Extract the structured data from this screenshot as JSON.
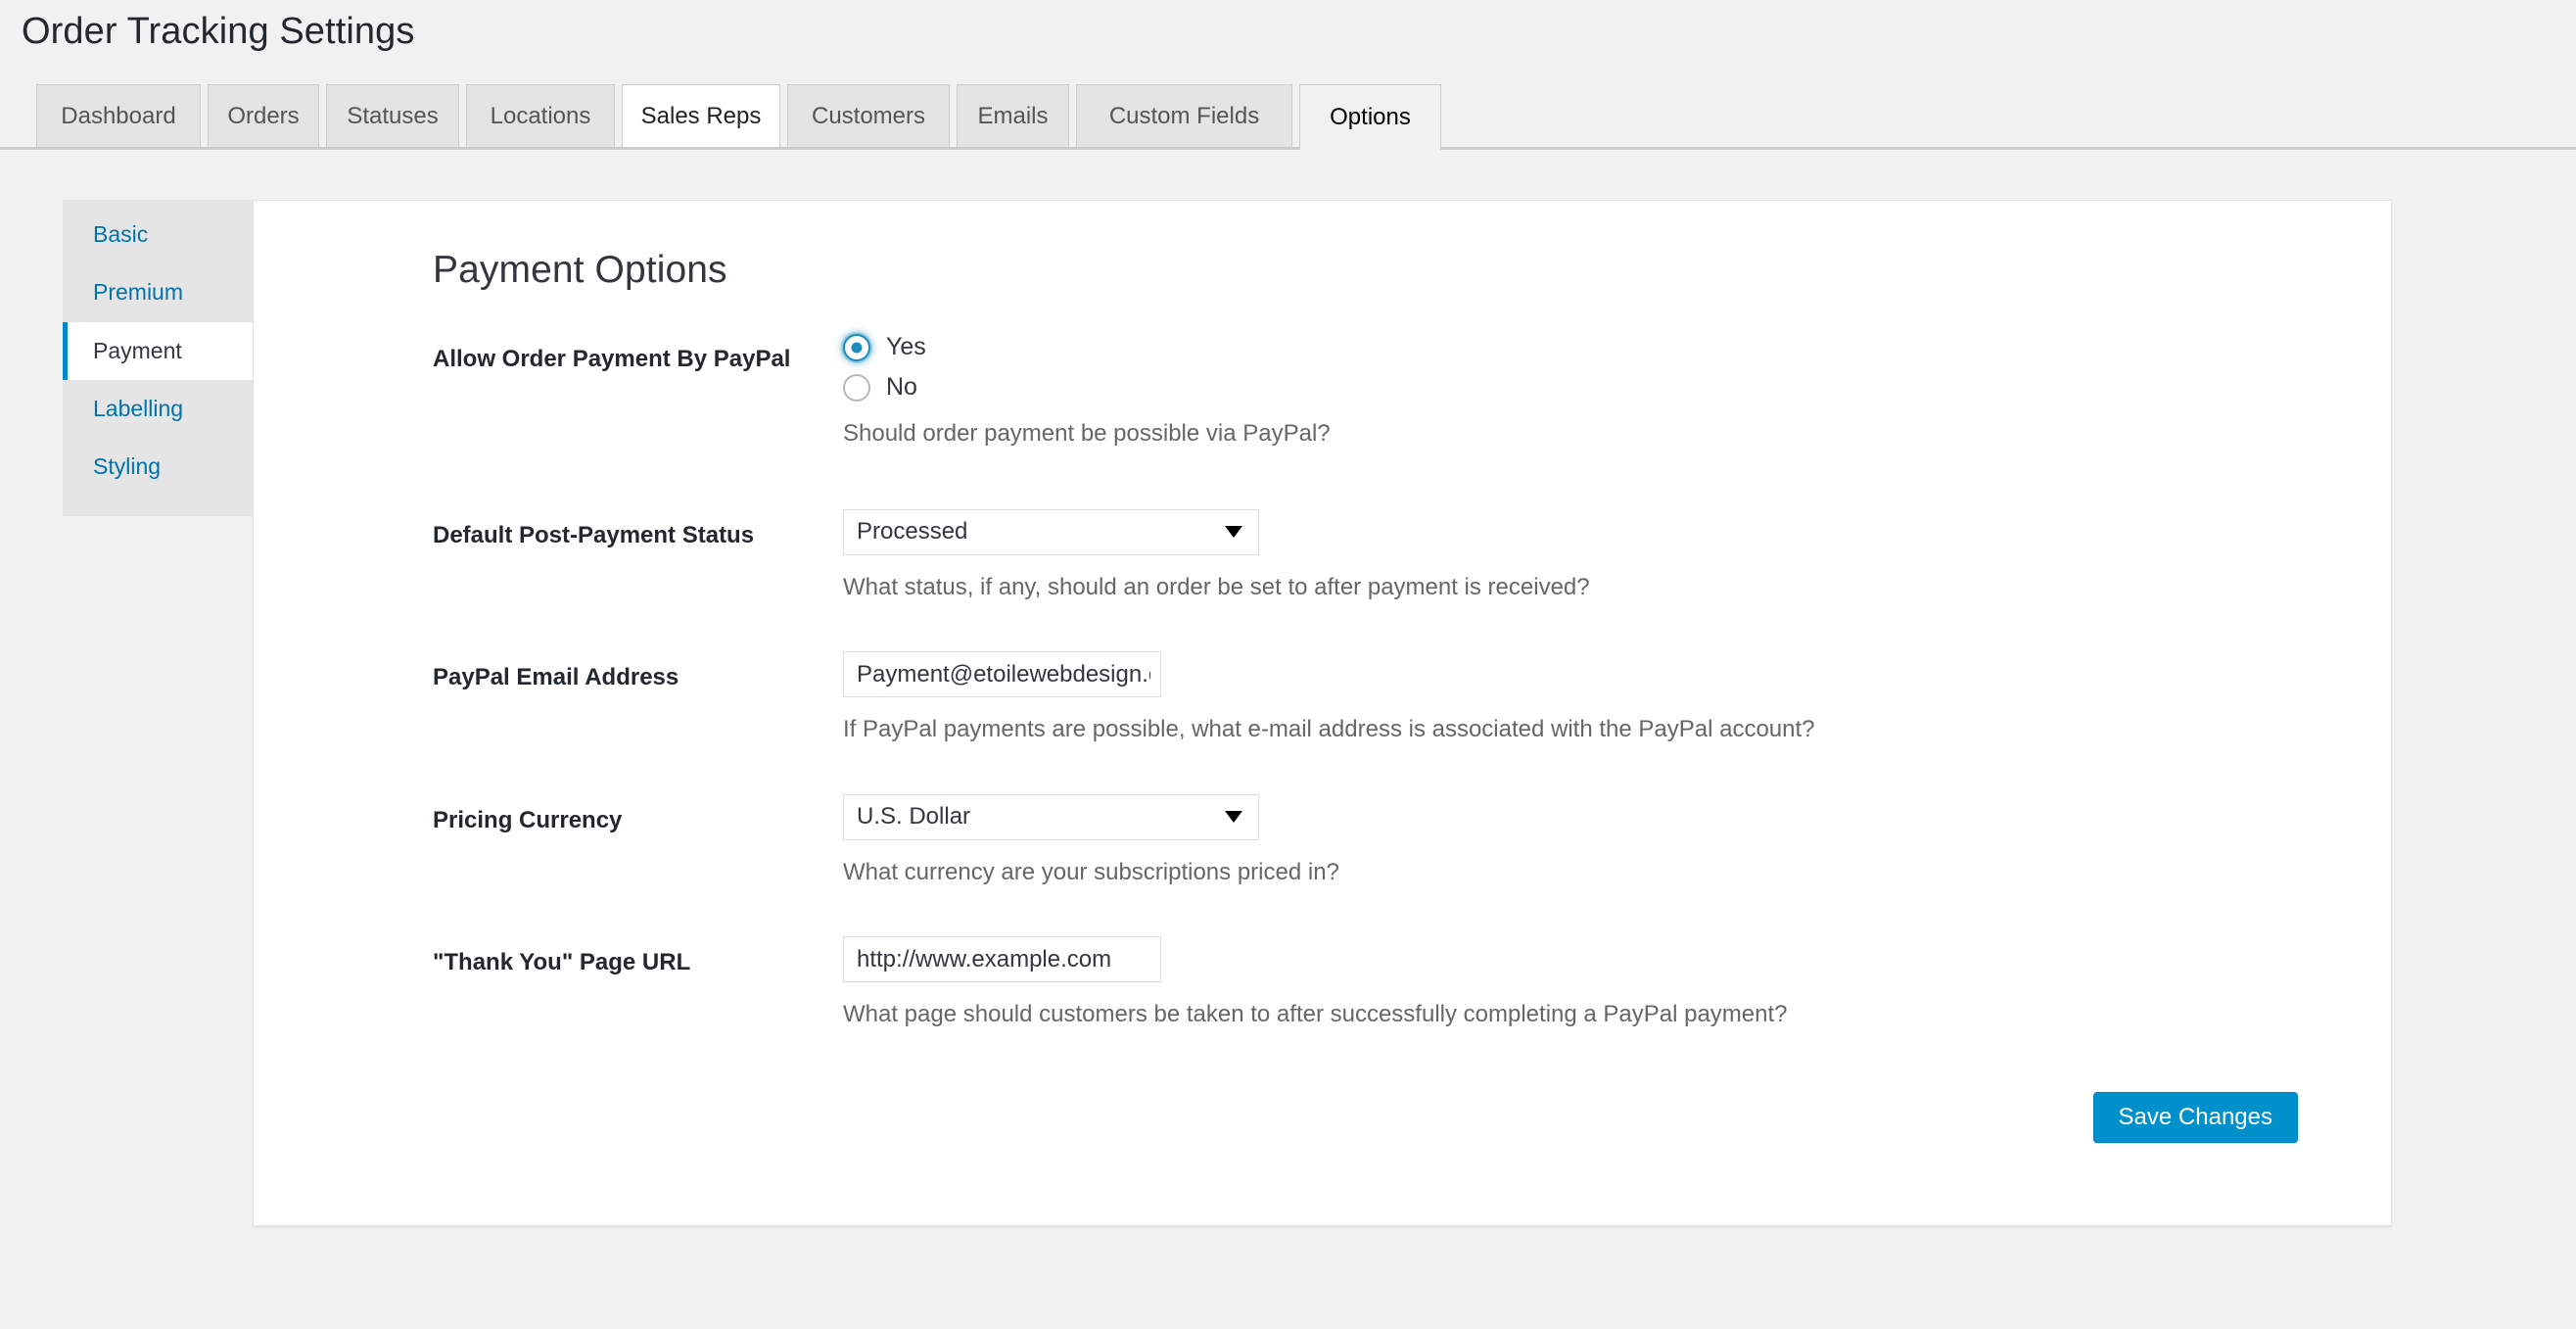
{
  "page": {
    "title": "Order Tracking Settings"
  },
  "tabs": [
    {
      "label": "Dashboard",
      "state": "normal"
    },
    {
      "label": "Orders",
      "state": "normal"
    },
    {
      "label": "Statuses",
      "state": "normal"
    },
    {
      "label": "Locations",
      "state": "normal"
    },
    {
      "label": "Sales Reps",
      "state": "hovered"
    },
    {
      "label": "Customers",
      "state": "normal"
    },
    {
      "label": "Emails",
      "state": "normal"
    },
    {
      "label": "Custom Fields",
      "state": "normal"
    },
    {
      "label": "Options",
      "state": "active"
    }
  ],
  "sidebar": {
    "items": [
      {
        "label": "Basic",
        "active": false
      },
      {
        "label": "Premium",
        "active": false
      },
      {
        "label": "Payment",
        "active": true
      },
      {
        "label": "Labelling",
        "active": false
      },
      {
        "label": "Styling",
        "active": false
      }
    ]
  },
  "main": {
    "heading": "Payment Options",
    "fields": {
      "paypal_allowed": {
        "label": "Allow Order Payment By PayPal",
        "options": [
          {
            "label": "Yes",
            "checked": true
          },
          {
            "label": "No",
            "checked": false
          }
        ],
        "description": "Should order payment be possible via PayPal?"
      },
      "post_payment_status": {
        "label": "Default Post-Payment Status",
        "value": "Processed",
        "description": "What status, if any, should an order be set to after payment is received?"
      },
      "paypal_email": {
        "label": "PayPal Email Address",
        "value": "Payment@etoilewebdesign.com",
        "placeholder": "",
        "description": "If PayPal payments are possible, what e-mail address is associated with the PayPal account?"
      },
      "pricing_currency": {
        "label": "Pricing Currency",
        "value": "U.S. Dollar",
        "description": "What currency are your subscriptions priced in?"
      },
      "thank_you_url": {
        "label": "\"Thank You\" Page URL",
        "value": "http://www.example.com",
        "placeholder": "",
        "description": "What page should customers be taken to after successfully completing a PayPal payment?"
      }
    },
    "save_label": "Save Changes"
  },
  "colors": {
    "accent": "#0073aa",
    "active_border": "#0088cc",
    "button": "#0091cd",
    "radio_checked": "#1e8cbe",
    "page_bg": "#f1f1f1"
  }
}
